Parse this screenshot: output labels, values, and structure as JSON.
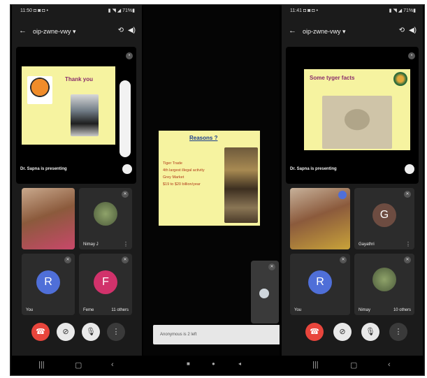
{
  "screens": [
    {
      "status_left": "11:50 ◘ ◙ ◘ •",
      "status_right": "▮ ◥ ◢ 71%▮",
      "meeting_code": "oip-zwne-vwy ▾",
      "slide_title": "Thank you",
      "presenting_label": "Dr. Sapna is presenting",
      "tiles": [
        {
          "name": "",
          "label": ""
        },
        {
          "name": "Nimay J",
          "label": "Nimay J"
        },
        {
          "name": "You",
          "letter": "R",
          "color": "#4f6fd8"
        },
        {
          "name": "Feme",
          "letter": "F",
          "color": "#d1326b",
          "others": "11 others"
        }
      ]
    },
    {
      "status_left": "",
      "status_right": "",
      "slide_title": "Reasons ?",
      "bullets": [
        "Tiger Trade",
        "4th largest illegal activity",
        "Grey Market",
        "$19 to $20 billion/year"
      ],
      "caption_placeholder": "Anonymous is 2 left"
    },
    {
      "status_left": "11:41 ◘ ◙ ◘ •",
      "status_right": "▮ ◥ ◢ 71%▮",
      "meeting_code": "oip-zwne-vwy ▾",
      "slide_title": "Some tyger facts",
      "presenting_label": "Dr. Sapna is presenting",
      "tiles": [
        {
          "name": "",
          "label": ""
        },
        {
          "name": "Gayathri",
          "letter": "G",
          "color": "#6d4c41"
        },
        {
          "name": "You",
          "letter": "R",
          "color": "#4f6fd8"
        },
        {
          "name": "Nimay",
          "others": "10 others"
        }
      ]
    }
  ],
  "icons": {
    "back": "←",
    "camera-switch": "⟲",
    "speaker": "◀)",
    "end-call": "☎",
    "cam-off": "⊘",
    "mic": "🎙",
    "more": "⋮",
    "nav-recent": "|||",
    "nav-home": "▢",
    "nav-back": "‹"
  }
}
